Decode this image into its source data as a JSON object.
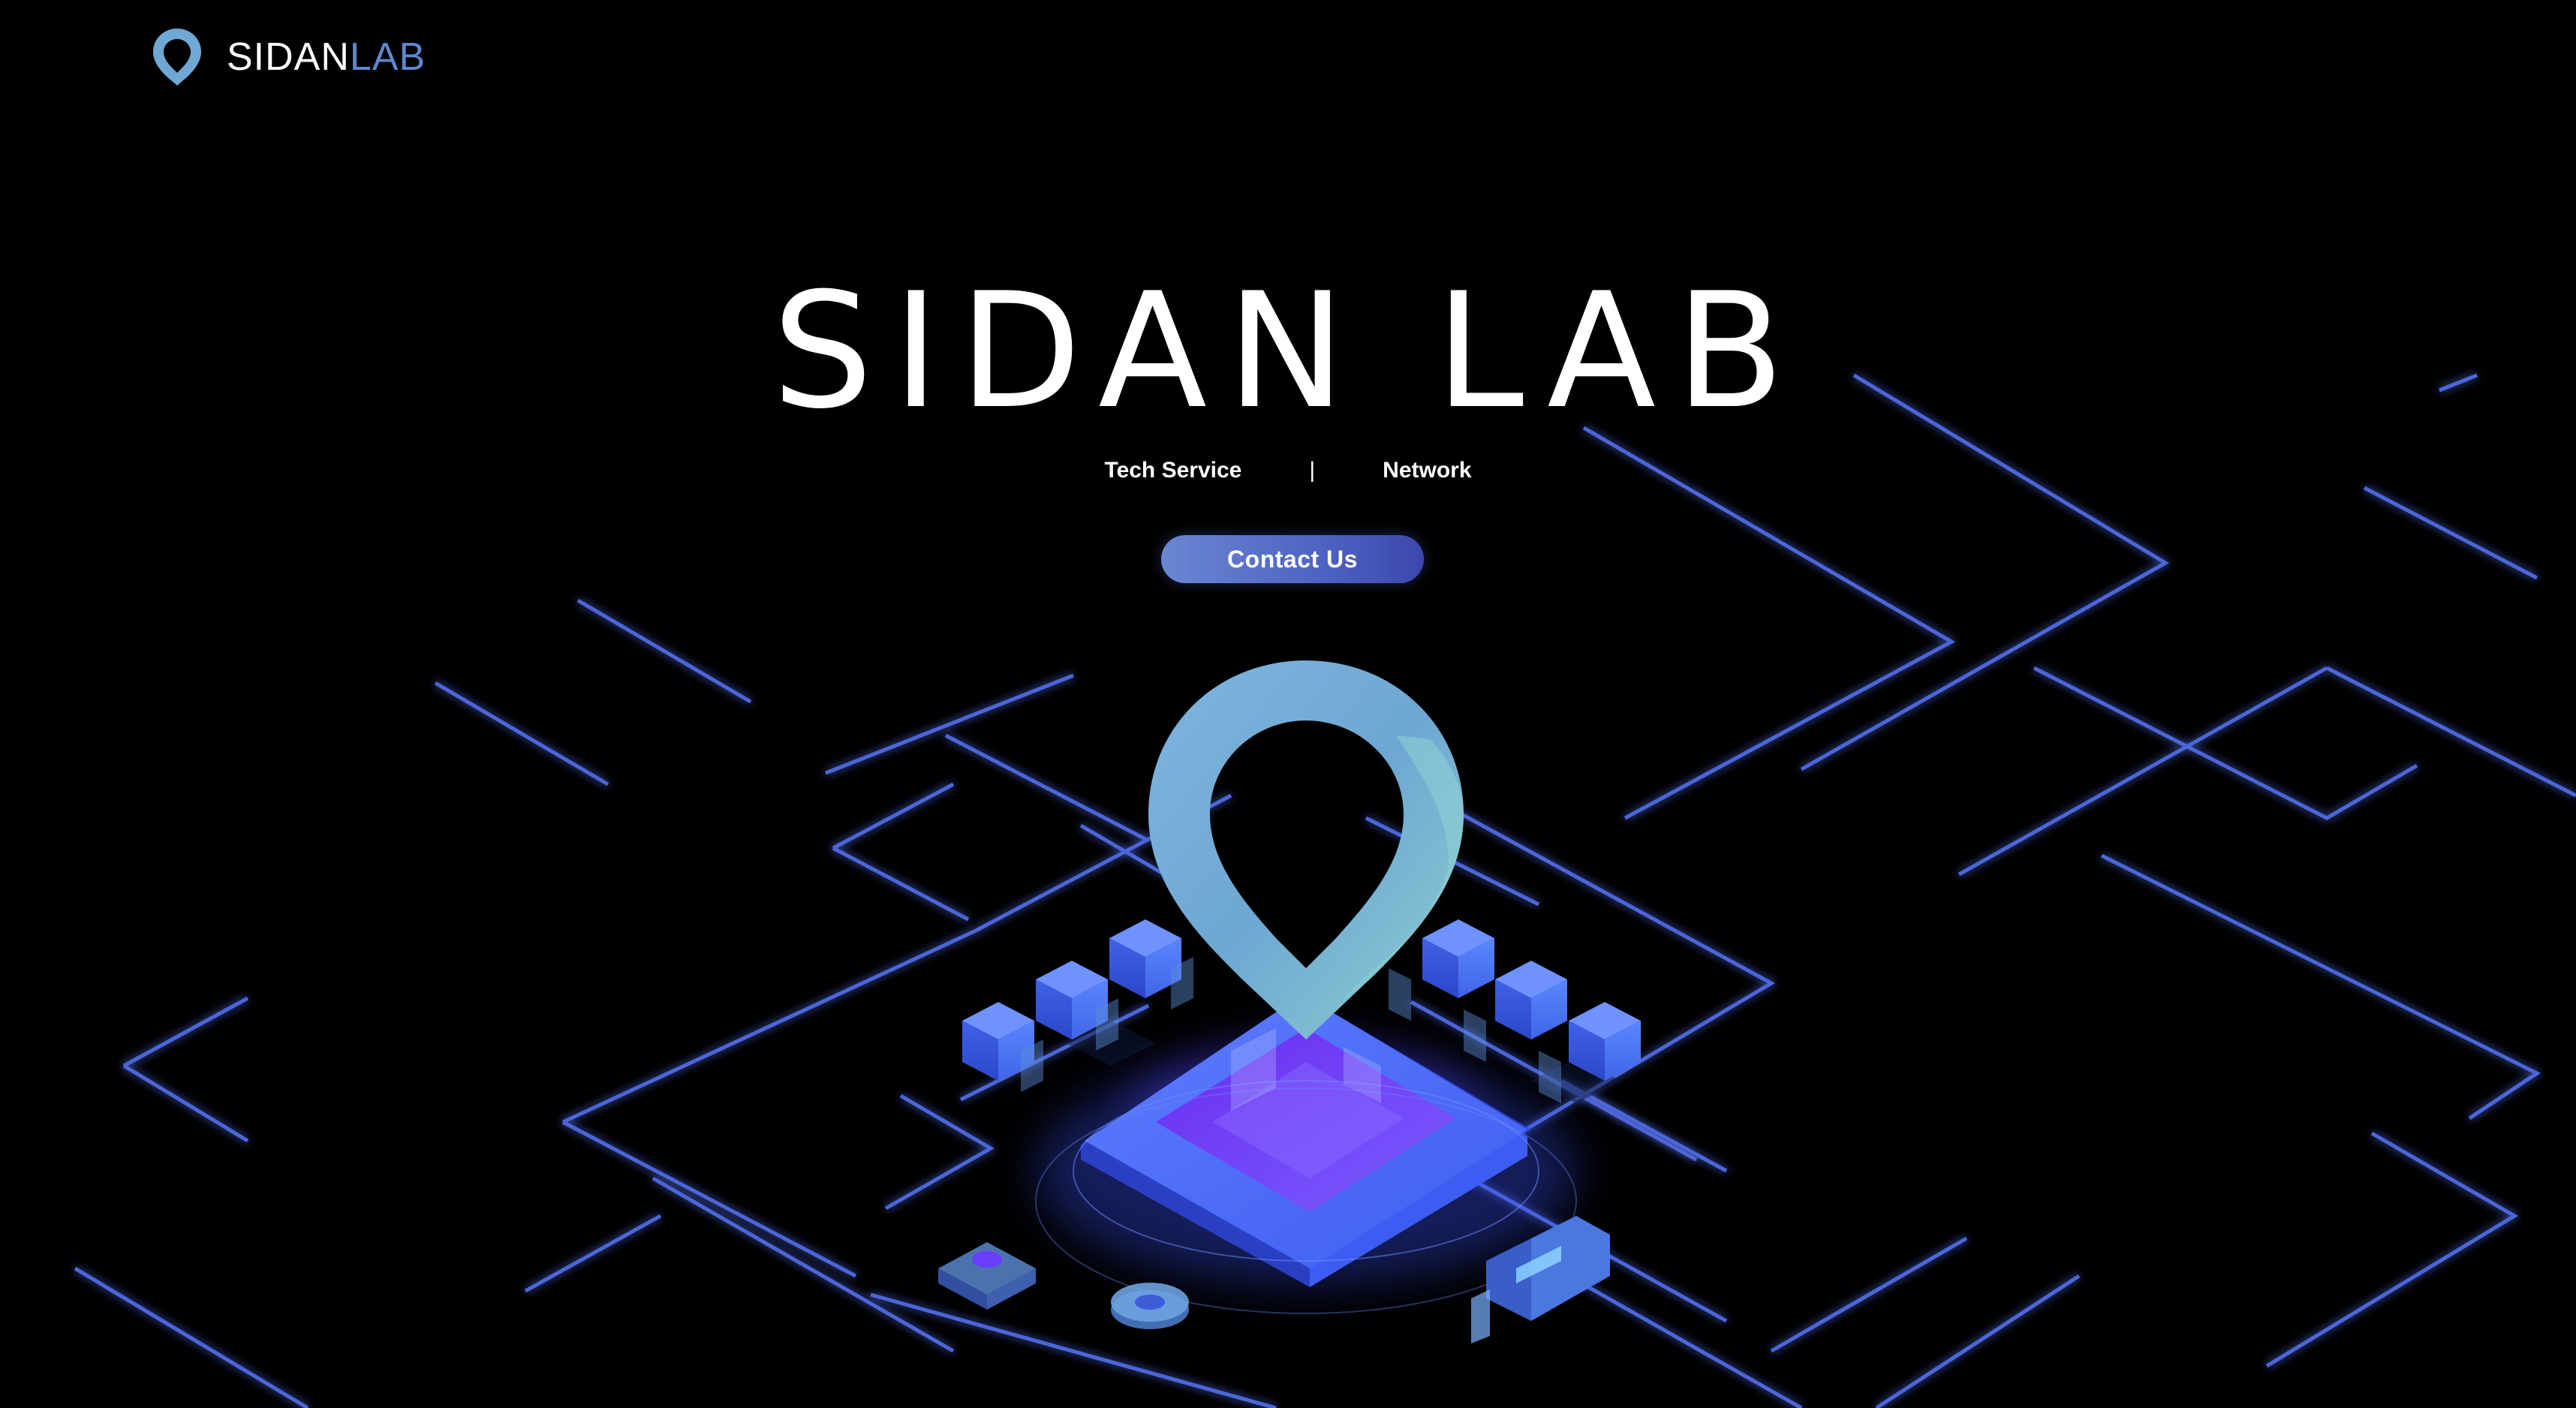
{
  "header": {
    "logo_icon": "location-pin-icon",
    "brand_part1": "SIDAN",
    "brand_part2": "LAB",
    "brand_color": "#5e87cf"
  },
  "hero": {
    "title": "SIDAN LAB",
    "tag1": "Tech Service",
    "separator": "|",
    "tag2": "Network",
    "cta_label": "Contact Us"
  },
  "colors": {
    "background": "#000000",
    "accent_blue": "#4e64c2",
    "pin_teal": "#7ab4d6",
    "glow_blue": "#4a6cff",
    "platform_violet": "#5a3df0"
  },
  "illustration": {
    "pin_icon": "location-pin-icon",
    "platform": "isometric-platform",
    "blocks": "isometric-server-cube-icon"
  }
}
